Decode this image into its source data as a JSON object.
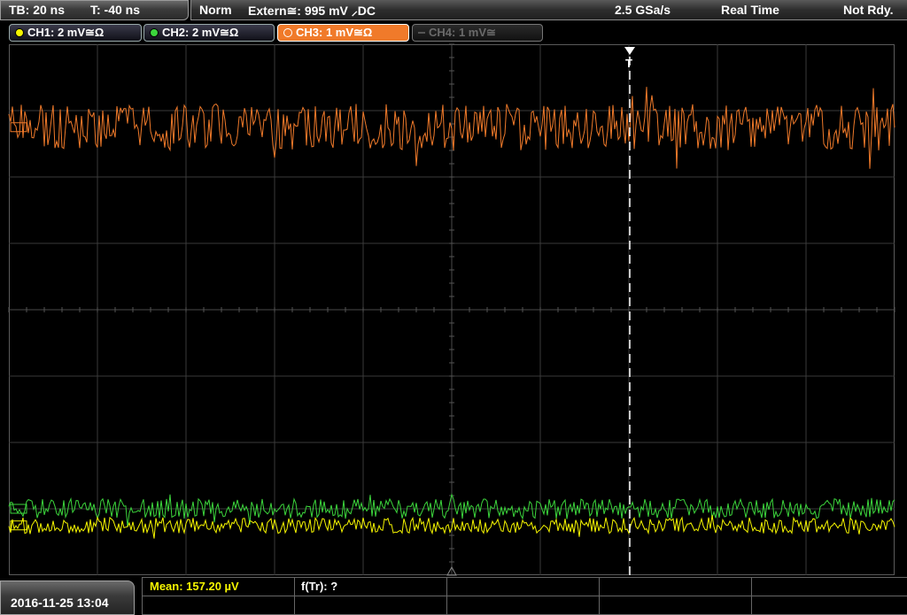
{
  "timebase": {
    "tb": "TB: 20 ns",
    "trigger_time": "T: -40 ns"
  },
  "status": {
    "trigger_mode": "Norm",
    "trigger_source": "Extern≅: 995 mV ⸝DC",
    "sample_rate": "2.5 GSa/s",
    "acq_mode": "Real Time",
    "state": "Not Rdy."
  },
  "channels": [
    {
      "label": "CH1: 2 mV≅Ω",
      "color": "#f5f500",
      "state": "on"
    },
    {
      "label": "CH2: 2 mV≅Ω",
      "color": "#3cd53c",
      "state": "on"
    },
    {
      "label": "CH3: 1 mV≅Ω",
      "color": "#f07a2a",
      "state": "active"
    },
    {
      "label": "CH4: 1 mV≅",
      "color": "#555555",
      "state": "off"
    }
  ],
  "trigger_marker": "T",
  "timestamp": "2016-11-25 13:04",
  "measurements": {
    "mean": "Mean: 157.20 µV",
    "ftr": "f(Tr): ?"
  },
  "chart_data": {
    "type": "line",
    "title": "",
    "xlabel": "",
    "ylabel": "",
    "grid": true,
    "divisions": {
      "x": 10,
      "y": 8
    },
    "series": [
      {
        "name": "CH3",
        "color": "#f07a2a",
        "baseline_div": 1.25,
        "amplitude_div": 0.35,
        "seed": 3
      },
      {
        "name": "CH2",
        "color": "#3cd53c",
        "baseline_div": 7.0,
        "amplitude_div": 0.15,
        "seed": 2
      },
      {
        "name": "CH1",
        "color": "#f5f500",
        "baseline_div": 7.25,
        "amplitude_div": 0.12,
        "seed": 1
      }
    ]
  }
}
